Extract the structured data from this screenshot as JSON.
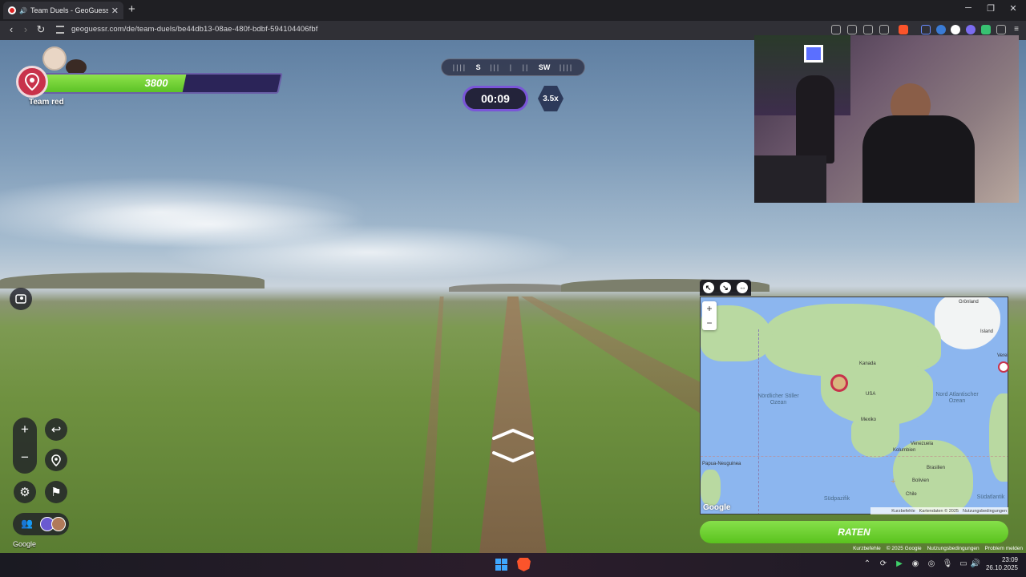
{
  "browser": {
    "tab_title": "Team Duels - GeoGuessr",
    "url": "geoguessr.com/de/team-duels/be44db13-08ae-480f-bdbf-594104406fbf"
  },
  "hud": {
    "team_label": "Team red",
    "health_value": "3800",
    "health_fraction": 0.6,
    "compass": [
      "S",
      "SW"
    ],
    "timer": "00:09",
    "multiplier": "3.5x",
    "colors": {
      "team_red": "#c8324b",
      "health_green": "#6fd334",
      "accent_purple": "#7a55d8"
    }
  },
  "scene": {
    "google_label": "Google",
    "footer": [
      "Kurzbefehle",
      "© 2025 Google",
      "Nutzungsbedingungen",
      "Problem melden"
    ]
  },
  "map": {
    "labels": {
      "groenland": "Grönland",
      "island": "Island",
      "kanada": "Kanada",
      "usa": "USA",
      "mexiko": "Mexiko",
      "noerdlicher_stiller_ozean": "Nördlicher Stiller Ozean",
      "nord_atlantischer_ozean": "Nord Atlantischer Ozean",
      "venezuela": "Venezuela",
      "kolumbien": "Kolumbien",
      "brasilien": "Brasilien",
      "bolivien": "Bolivien",
      "chile": "Chile",
      "suedpazifik": "Südpazifik",
      "suedatlantik": "Südatlantik",
      "neuguinea": "Papua-Neuguinea",
      "vereinigte": "Verei"
    },
    "google_logo": "Google",
    "footer": [
      "Kurzbefehle",
      "Kartendaten © 2025",
      "Nutzungsbedingungen"
    ],
    "guess_button": "RATEN",
    "zoom_in": "+",
    "zoom_out": "−"
  },
  "taskbar": {
    "time": "23:09",
    "date": "26.10.2025"
  }
}
